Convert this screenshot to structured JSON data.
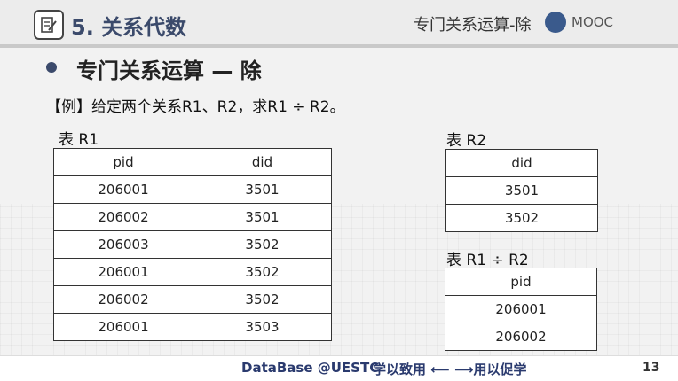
{
  "header": {
    "chapter_title": "5. 关系代数",
    "topic": "专门关系运算-除",
    "brand": "MOOC"
  },
  "section": {
    "title": "专门关系运算 — 除",
    "example": "【例】给定两个关系R1、R2，求R1 ÷ R2。"
  },
  "r1": {
    "label": "表 R1",
    "headers": [
      "pid",
      "did"
    ],
    "rows": [
      [
        "206001",
        "3501"
      ],
      [
        "206002",
        "3501"
      ],
      [
        "206003",
        "3502"
      ],
      [
        "206001",
        "3502"
      ],
      [
        "206002",
        "3502"
      ],
      [
        "206001",
        "3503"
      ]
    ]
  },
  "r2": {
    "label": "表 R2",
    "headers": [
      "did"
    ],
    "rows": [
      [
        "3501"
      ],
      [
        "3502"
      ]
    ]
  },
  "result": {
    "label": "表 R1 ÷ R2",
    "headers": [
      "pid"
    ],
    "rows": [
      [
        "206001"
      ],
      [
        "206002"
      ]
    ]
  },
  "footer": {
    "course": "DataBase @UESTC",
    "motto": "学以致用 ⟵ ⟶用以促学",
    "page": "13"
  },
  "colors": {
    "title": "#3b4a6b",
    "footer_text": "#2a3a6e"
  }
}
